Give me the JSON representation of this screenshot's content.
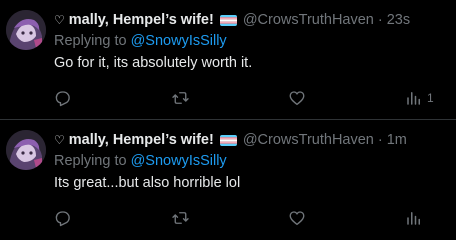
{
  "colors": {
    "background": "#000000",
    "text": "#e7e9ea",
    "muted": "#71767b",
    "link": "#1d9bf0",
    "divider": "#2f3336"
  },
  "tweets": [
    {
      "heart_glyph": "♡",
      "display_name": "mally, Hempel’s wife!",
      "handle": "@CrowsTruthHaven",
      "separator": "·",
      "time": "23s",
      "replying_prefix": "Replying to ",
      "replying_to": "@SnowyIsSilly",
      "text": "Go for it, its absolutely worth it.",
      "views_count": "1"
    },
    {
      "heart_glyph": "♡",
      "display_name": "mally, Hempel’s wife!",
      "handle": "@CrowsTruthHaven",
      "separator": "·",
      "time": "1m",
      "replying_prefix": "Replying to ",
      "replying_to": "@SnowyIsSilly",
      "text": "Its great...but also horrible lol",
      "views_count": ""
    }
  ],
  "icons": {
    "reply": "reply-icon",
    "retweet": "retweet-icon",
    "like": "like-icon",
    "views": "views-icon",
    "flag": "trans-flag-icon"
  }
}
